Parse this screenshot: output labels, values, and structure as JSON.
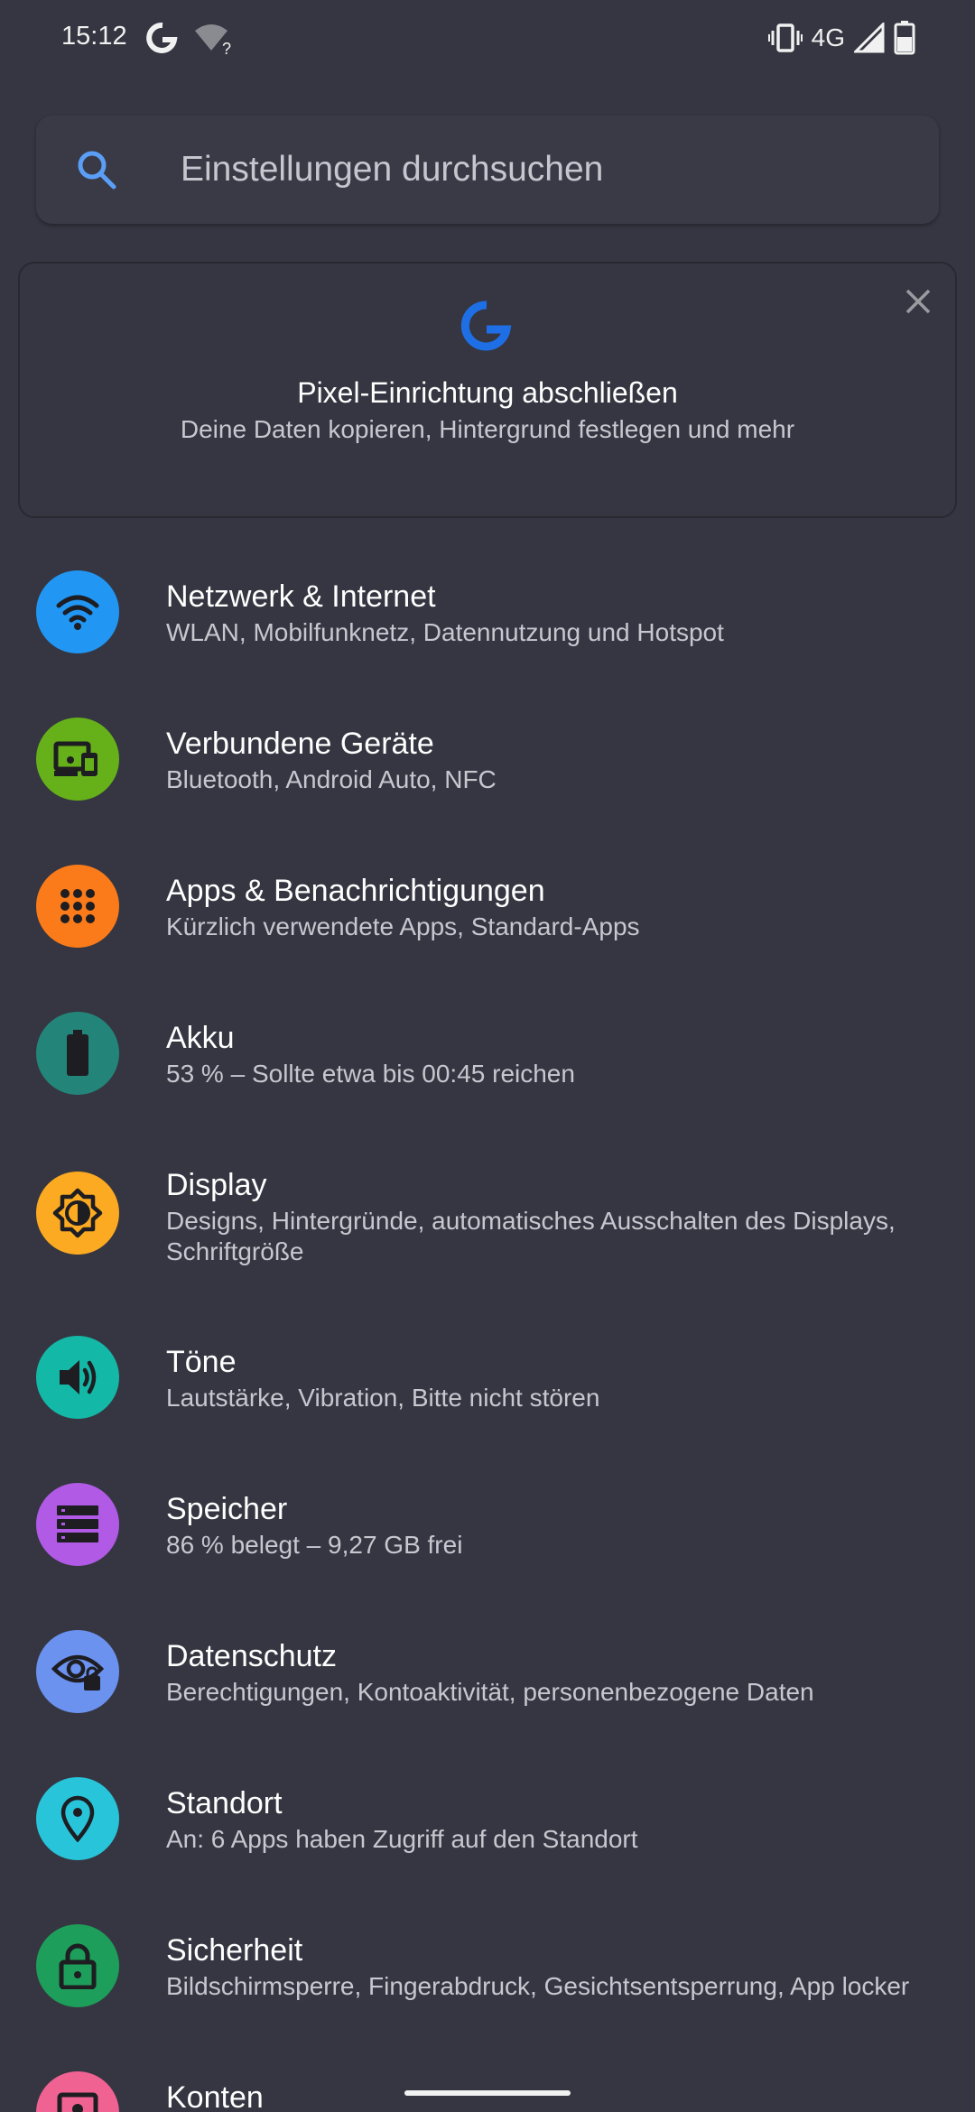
{
  "status_bar": {
    "time": "15:12",
    "network": "4G"
  },
  "search": {
    "placeholder": "Einstellungen durchsuchen"
  },
  "setup_card": {
    "title": "Pixel-Einrichtung abschließen",
    "subtitle": "Deine Daten kopieren, Hintergrund festlegen und mehr"
  },
  "settings": [
    {
      "title": "Netzwerk & Internet",
      "subtitle": "WLAN, Mobilfunknetz, Datennutzung und Hotspot",
      "icon": "wifi-icon",
      "color": "#2196f3"
    },
    {
      "title": "Verbundene Geräte",
      "subtitle": "Bluetooth, Android Auto, NFC",
      "icon": "devices-icon",
      "color": "#66b11a"
    },
    {
      "title": "Apps & Benachrichtigungen",
      "subtitle": "Kürzlich verwendete Apps, Standard-Apps",
      "icon": "apps-grid-icon",
      "color": "#fb7b1a"
    },
    {
      "title": "Akku",
      "subtitle": "53 % – Sollte etwa bis 00:45 reichen",
      "icon": "battery-icon",
      "color": "#23847a"
    },
    {
      "title": "Display",
      "subtitle": "Designs, Hintergründe, automatisches Ausschalten des Displays, Schriftgröße",
      "icon": "brightness-icon",
      "color": "#fbaa21"
    },
    {
      "title": "Töne",
      "subtitle": "Lautstärke, Vibration, Bitte nicht stören",
      "icon": "volume-icon",
      "color": "#14b8a6"
    },
    {
      "title": "Speicher",
      "subtitle": "86 % belegt – 9,27 GB frei",
      "icon": "storage-icon",
      "color": "#b05ae6"
    },
    {
      "title": "Datenschutz",
      "subtitle": "Berechtigungen, Kontoaktivität, personenbezogene Daten",
      "icon": "privacy-eye-icon",
      "color": "#6b92ef"
    },
    {
      "title": "Standort",
      "subtitle": "An: 6 Apps haben Zugriff auf den Standort",
      "icon": "location-pin-icon",
      "color": "#28c4d9"
    },
    {
      "title": "Sicherheit",
      "subtitle": "Bildschirmsperre, Fingerabdruck, Gesichtsentsperrung, App locker",
      "icon": "lock-icon",
      "color": "#1e9e5b"
    },
    {
      "title": "Konten",
      "subtitle": "",
      "icon": "account-icon",
      "color": "#f06292"
    }
  ]
}
